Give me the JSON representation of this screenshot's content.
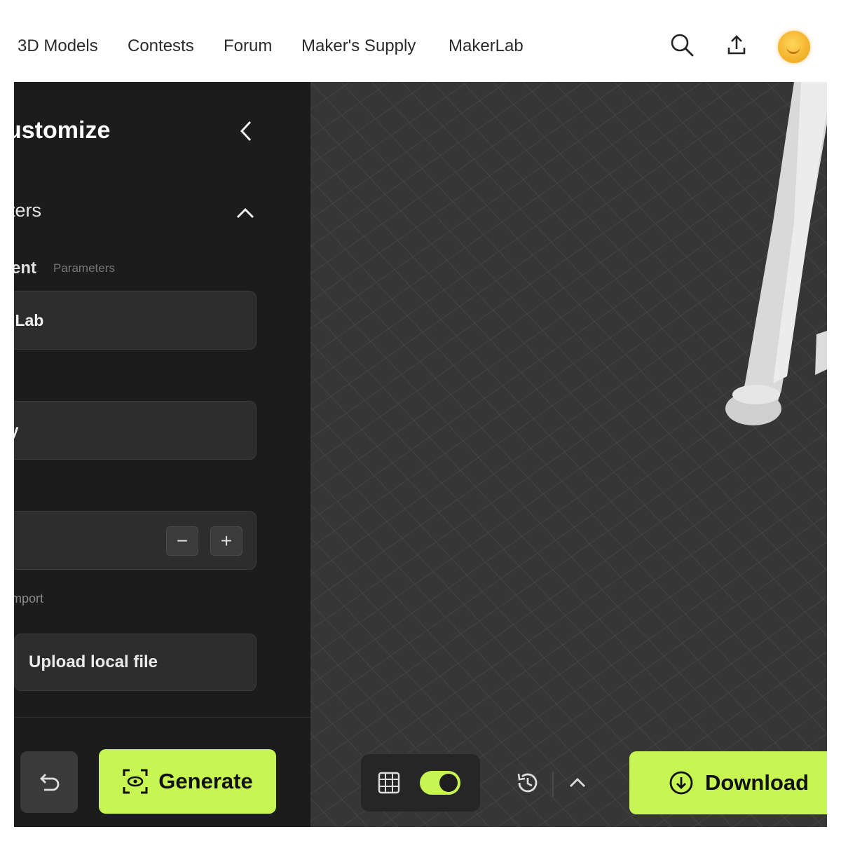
{
  "nav": {
    "links": [
      "3D Models",
      "Contests",
      "Forum",
      "Maker's Supply",
      "MakerLab"
    ],
    "icons": [
      "search-icon",
      "upload-icon",
      "avatar"
    ]
  },
  "panel": {
    "title": "ustomize",
    "section_title": "ters",
    "row_label": "ent",
    "row_sub": "Parameters",
    "field1_value": "u Lab",
    "field1_label": "",
    "field2_value": "ay",
    "stepper_minus": "−",
    "stepper_plus": "+",
    "import_label": "mport",
    "upload_label": "Upload local file"
  },
  "footer": {
    "generate_label": "Generate"
  },
  "viewport": {
    "download_label": "Download",
    "grid_toggle_on": true
  },
  "colors": {
    "accent": "#c7f552",
    "panel_bg": "#1c1c1c",
    "viewport_bg": "#363636"
  }
}
